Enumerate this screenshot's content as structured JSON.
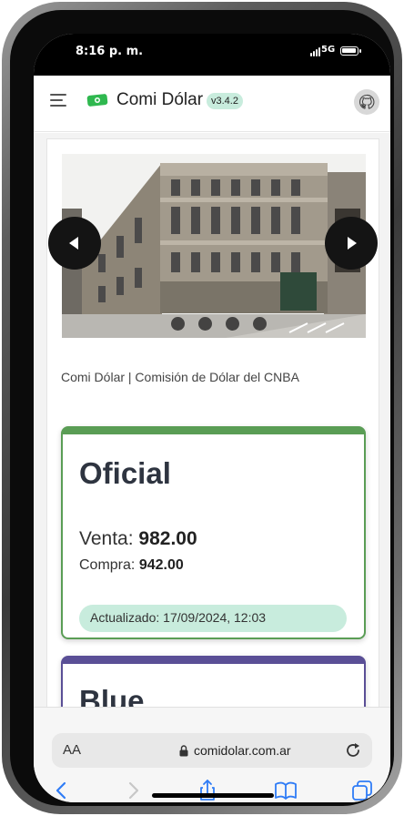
{
  "status": {
    "time": "8:16 p. m.",
    "network": "5G"
  },
  "app": {
    "name": "Comi Dólar",
    "version": "v3.4.2"
  },
  "icons": {
    "menu": "hamburger-icon",
    "logo": "money-bill-icon",
    "github": "github-icon",
    "prev": "chevron-left-icon",
    "next": "chevron-right-icon",
    "lock": "lock-icon",
    "reload": "reload-icon",
    "share": "share-icon",
    "bookmarks": "book-icon",
    "tabs": "tabs-icon"
  },
  "carousel": {
    "caption": "Comi Dólar | Comisión de Dólar del CNBA",
    "slide_count": 4
  },
  "rates": [
    {
      "title": "Oficial",
      "sell_label": "Venta:",
      "sell_value": "982.00",
      "buy_label": "Compra:",
      "buy_value": "942.00",
      "updated": "Actualizado: 17/09/2024, 12:03",
      "accent": "#5a9d55"
    },
    {
      "title": "Blue",
      "accent": "#5a4f96"
    }
  ],
  "browser": {
    "aa_label": "AA",
    "url": "comidolar.com.ar"
  }
}
